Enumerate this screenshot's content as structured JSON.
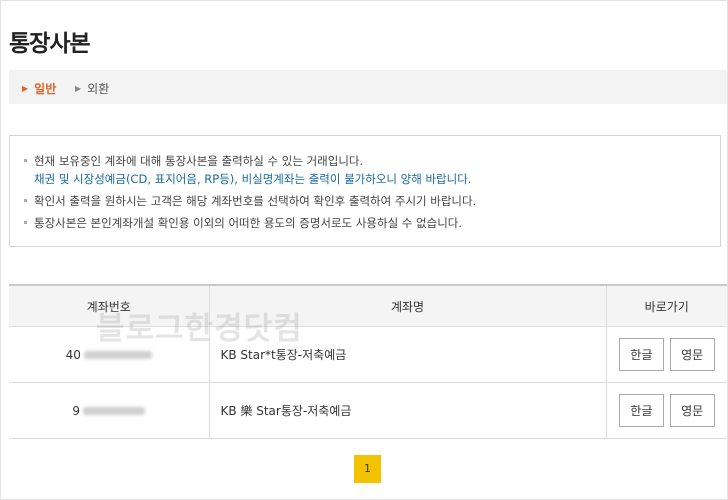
{
  "page": {
    "title": "통장사본"
  },
  "tabs": [
    {
      "label": "일반",
      "active": true
    },
    {
      "label": "외환",
      "active": false
    }
  ],
  "notice": {
    "items": [
      "현재 보유중인 계좌에 대해 통장사본을 출력하실 수 있는 거래입니다.",
      "확인서 출력을 원하시는 고객은 해당 계좌번호를 선택하여 확인후 출력하여 주시기 바랍니다.",
      "통장사본은 본인계좌개설 확인용 이외의 어떠한 용도의 증명서로도 사용하실 수 없습니다."
    ],
    "highlight": "채권 및 시장성예금(CD, 표지어음, RP등), 비실명계좌는 출력이 불가하오니 양해 바랍니다."
  },
  "table": {
    "headers": [
      "계좌번호",
      "계좌명",
      "바로가기"
    ],
    "rows": [
      {
        "account_visible": "40",
        "name": "KB Star*t통장-저축예금",
        "btn_korean": "한글",
        "btn_english": "영문"
      },
      {
        "account_visible": "9",
        "name": "KB 樂 Star통장-저축예금",
        "btn_korean": "한글",
        "btn_english": "영문"
      }
    ]
  },
  "watermark": "블로그한경닷컴",
  "pagination": {
    "current": "1"
  },
  "colors": {
    "active_tab": "#e0632b",
    "highlight_text": "#1b6a9e",
    "pager_bg": "#f4c300",
    "tab_bar_bg": "#f3f3f3"
  }
}
